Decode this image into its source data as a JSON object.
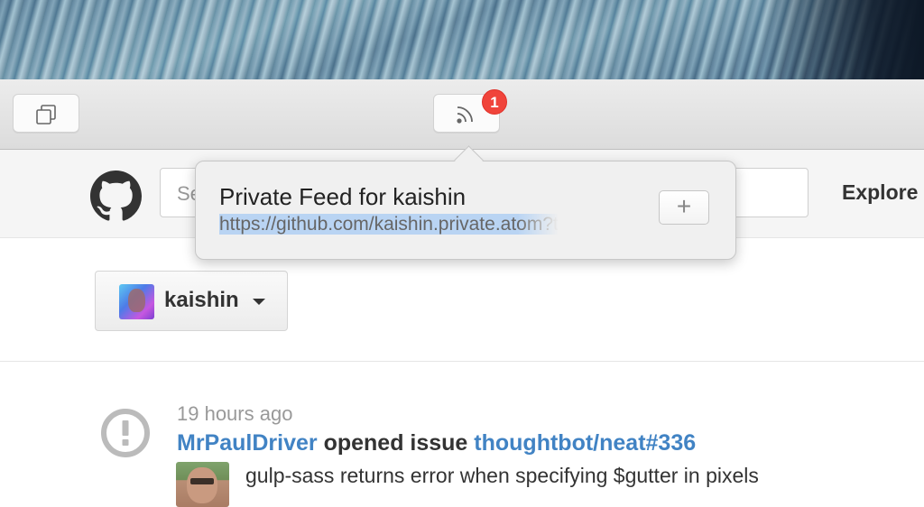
{
  "browser": {
    "feed_badge_count": "1"
  },
  "github_header": {
    "search_placeholder": "Se",
    "explore_label": "Explore"
  },
  "feed_popover": {
    "title": "Private Feed for kaishin",
    "url": "https://github.com/kaishin.private.atom?t",
    "add_label": "+"
  },
  "account_switcher": {
    "username": "kaishin"
  },
  "news_feed": {
    "items": [
      {
        "time": "19 hours ago",
        "actor": "MrPaulDriver",
        "action": " opened issue ",
        "target": "thoughtbot/neat#336",
        "summary": "gulp-sass returns error when specifying $gutter in pixels",
        "icon": "issue-opened-icon"
      }
    ]
  },
  "colors": {
    "link": "#4183c4",
    "badge": "#f0443b",
    "text": "#333333",
    "muted": "#999999"
  }
}
